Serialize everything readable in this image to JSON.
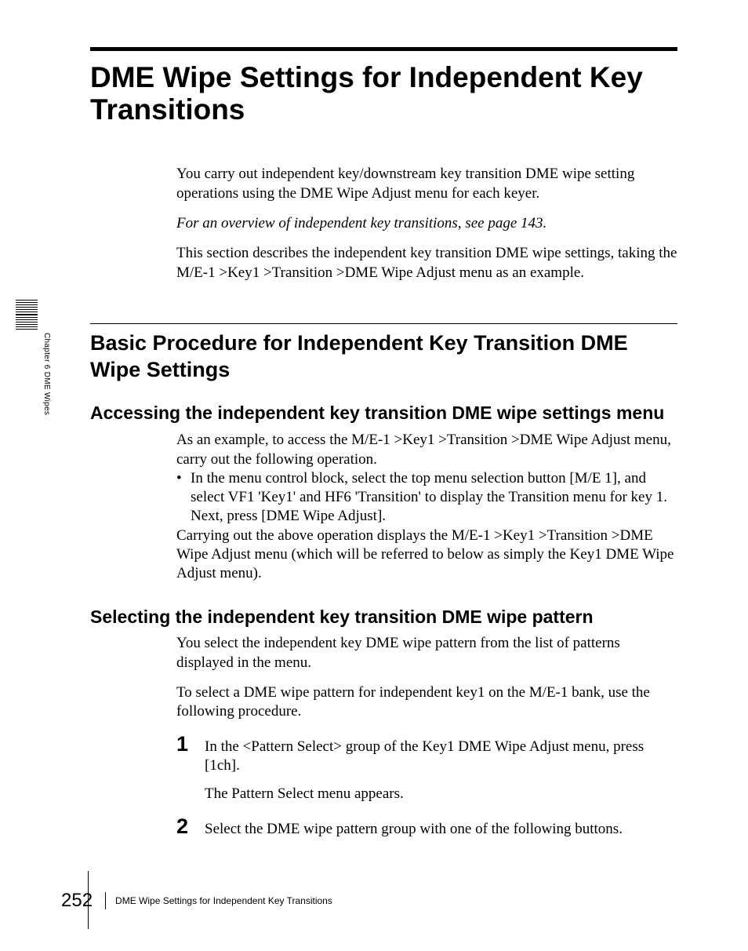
{
  "main_title": "DME Wipe Settings for Independent Key Transitions",
  "intro": {
    "p1": "You carry out independent key/downstream key transition DME wipe setting operations using the DME Wipe Adjust menu for each keyer.",
    "p2": "For an overview of independent key transitions, see page 143.",
    "p3": "This section describes the independent key transition DME wipe settings, taking the M/E-1 >Key1 >Transition >DME Wipe Adjust menu as an example."
  },
  "section1": {
    "heading": "Basic Procedure for Independent Key Transition DME Wipe Settings",
    "sub1": {
      "heading": "Accessing the independent key transition DME wipe settings menu",
      "p1": "As an example, to access the M/E-1 >Key1 >Transition >DME Wipe Adjust menu, carry out the following operation.",
      "bullet": "In the menu control block, select the top menu selection button [M/E 1], and select VF1 'Key1' and HF6 'Transition' to display the Transition menu for key 1. Next, press [DME Wipe Adjust].",
      "p2": "Carrying out the above operation displays the M/E-1 >Key1 >Transition >DME Wipe Adjust menu (which will be referred to below as simply the Key1 DME Wipe Adjust menu)."
    },
    "sub2": {
      "heading": "Selecting the independent key transition DME wipe pattern",
      "p1": "You select the independent key DME wipe pattern from the list of patterns displayed in the menu.",
      "p2": "To select a DME wipe pattern for independent key1 on the M/E-1 bank, use the following procedure.",
      "steps": [
        {
          "num": "1",
          "text": "In the <Pattern Select> group of the Key1 DME Wipe Adjust menu, press [1ch].",
          "sub": "The Pattern Select menu appears."
        },
        {
          "num": "2",
          "text": "Select the DME wipe pattern group with one of the following buttons."
        }
      ]
    }
  },
  "sidebar": {
    "label": "Chapter 6  DME Wipes"
  },
  "footer": {
    "page": "252",
    "title": "DME Wipe Settings for Independent Key Transitions"
  }
}
